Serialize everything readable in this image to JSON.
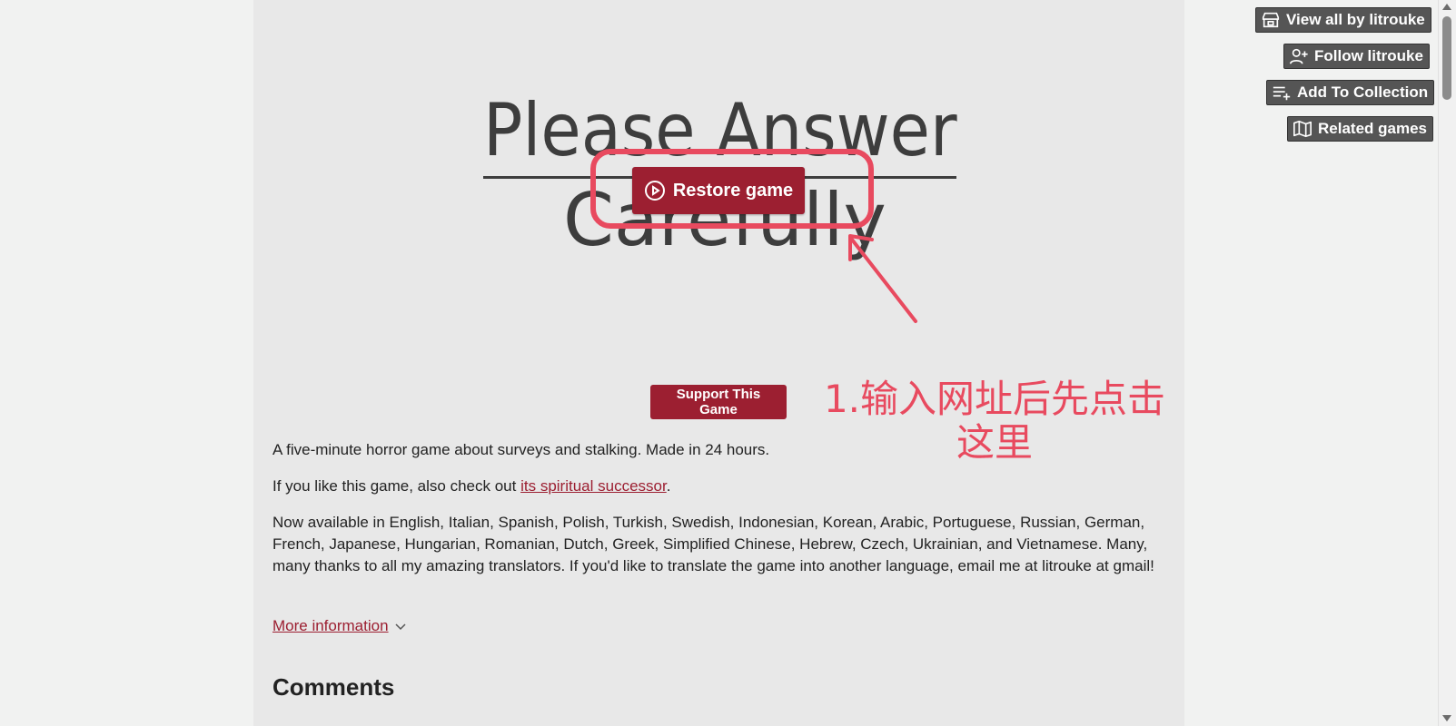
{
  "game": {
    "title_line1": "Please Answer",
    "title_line2": "Carefully",
    "restore_label": "Restore game"
  },
  "annotation": {
    "line1": "1.输入网址后先点击",
    "line2": "这里",
    "color": "#e84a5f"
  },
  "support_label": "Support This Game",
  "description": {
    "p1": "A five-minute horror game about surveys and stalking. Made in 24 hours.",
    "p2_before": "If you like this game, also check out ",
    "p2_link": "its spiritual successor",
    "p2_after": ".",
    "p3": "Now available in English, Italian, Spanish, Polish, Turkish, Swedish, Indonesian, Korean, Arabic, Portuguese, Russian, German, French, Japanese, Hungarian, Romanian, Dutch, Greek, Simplified Chinese, Hebrew, Czech, Ukrainian, and Vietnamese. Many, many thanks to all my amazing translators. If you'd like to translate the game into another language, email me at litrouke at gmail!"
  },
  "more_info_label": "More information",
  "comments_heading": "Comments",
  "sidebar": {
    "view_all": "View all by litrouke",
    "follow": "Follow litrouke",
    "add_collection": "Add To Collection",
    "related": "Related games"
  },
  "colors": {
    "accent": "#9c1f31",
    "background": "#f1f2f1",
    "content": "#e8e8e8",
    "side_button": "#555555"
  },
  "icons": {
    "restore": "play-circle-icon",
    "view_all": "itchio-store-icon",
    "follow": "user-plus-icon",
    "add_collection": "list-plus-icon",
    "related": "map-icon",
    "more_info": "chevron-down-icon"
  }
}
